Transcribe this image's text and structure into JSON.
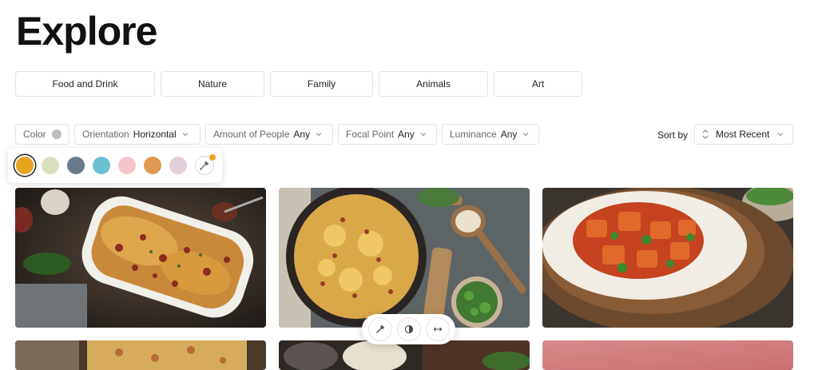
{
  "header": {
    "title": "Explore"
  },
  "categories": [
    "Food and Drink",
    "Nature",
    "Family",
    "Animals",
    "Art"
  ],
  "filters": {
    "color": {
      "label": "Color"
    },
    "orientation": {
      "label": "Orientation",
      "value": "Horizontal"
    },
    "people": {
      "label": "Amount of People",
      "value": "Any"
    },
    "focal": {
      "label": "Focal Point",
      "value": "Any"
    },
    "luminance": {
      "label": "Luminance",
      "value": "Any"
    }
  },
  "sort": {
    "label": "Sort by",
    "value": "Most Recent"
  },
  "palette": {
    "selected_index": 0,
    "swatches": [
      "#e8a321",
      "#dcdec0",
      "#6a7a8c",
      "#6cbfd1",
      "#f7c5c9",
      "#de9a4e",
      "#e2cfd9"
    ],
    "eyedropper_badge": "#e8a321",
    "eyedropper_icon": "eyedropper-icon"
  },
  "gallery": {
    "images": [
      {
        "subject": "baked pasta casserole with bacon",
        "dominant": "#c79045"
      },
      {
        "subject": "cheesy pasta in cast iron skillet",
        "dominant": "#d9a94a"
      },
      {
        "subject": "chicken curry with rice",
        "dominant": "#c4522a"
      },
      {
        "subject": "pasta bake",
        "dominant": "#8a6a44"
      },
      {
        "subject": "dish with ladle",
        "dominant": "#3a302a"
      },
      {
        "subject": "pink background",
        "dominant": "#d17b7e"
      }
    ]
  },
  "image_toolbar": {
    "icons": [
      "eyedropper-icon",
      "contrast-icon",
      "expand-horizontal-icon"
    ]
  }
}
